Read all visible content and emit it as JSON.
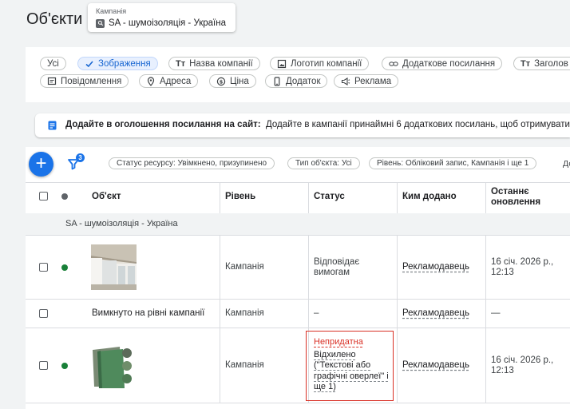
{
  "header": {
    "title": "Об'єкти",
    "campaign_label": "Кампанія",
    "campaign_name": "SA - шумоізоляція - Україна"
  },
  "chips_row1": [
    {
      "label": "Усі",
      "icon": ""
    },
    {
      "label": "Зображення",
      "icon": "check-icon",
      "selected": true
    },
    {
      "label": "Назва компанії",
      "icon": "text-icon"
    },
    {
      "label": "Логотип компанії",
      "icon": "image-icon"
    },
    {
      "label": "Додаткове посилання",
      "icon": "link-icon"
    },
    {
      "label": "Заголов",
      "icon": "text-icon"
    }
  ],
  "chips_row2": [
    {
      "label": "Повідомлення",
      "icon": "message-icon"
    },
    {
      "label": "Адреса",
      "icon": "location-pin-icon"
    },
    {
      "label": "Ціна",
      "icon": "price-icon"
    },
    {
      "label": "Додаток",
      "icon": "phone-icon"
    },
    {
      "label": "Реклама",
      "icon": "megaphone-icon"
    }
  ],
  "banner": {
    "bold": "Додайте в оголошення посилання на сайт:",
    "text": "Додайте в кампанії принаймні 6 додаткових посилань, щоб отримувати б"
  },
  "filters": {
    "badge": "3",
    "chips": [
      "Статус ресурсу: Увімкнено, призупинено",
      "Тип об'єкта: Усі",
      "Рівень: Обліковий запис, Кампанія і ще 1"
    ],
    "more": "До"
  },
  "table": {
    "headers": {
      "object": "Об'єкт",
      "level": "Рівень",
      "status": "Статус",
      "added_by": "Ким додано",
      "updated_line1": "Останнє",
      "updated_line2": "оновлення"
    },
    "group": "SA - шумоізоляція - Україна",
    "rows": [
      {
        "level": "Кампанія",
        "status_line1": "Відповідає",
        "status_line2": "вимогам",
        "added_by": "Рекламодавець",
        "updated_line1": "16 січ. 2026 р.,",
        "updated_line2": "12:13",
        "dot_color": "#188038"
      },
      {
        "object": "Вимкнуто на рівні кампанії",
        "level": "Кампанія",
        "status": "–",
        "added_by": "Рекламодавець",
        "updated": "—"
      },
      {
        "level": "Кампанія",
        "status_title": "Непридатна",
        "status_lines": [
          "Відхилено",
          "(\"Текстові або",
          "графічні оверлеї\" і",
          "ще 1)"
        ],
        "added_by": "Рекламодавець",
        "updated_line1": "16 січ. 2026 р.,",
        "updated_line2": "12:13",
        "dot_color": "#188038"
      }
    ]
  },
  "colors": {
    "accent": "#1a73e8",
    "error": "#d93025",
    "status_green": "#188038",
    "page_bg": "#f1f3f4"
  }
}
